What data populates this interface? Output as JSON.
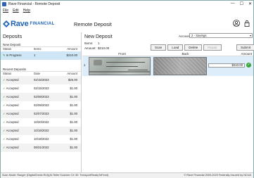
{
  "window": {
    "title": "Rave Financial - Remote Deposit",
    "controls": [
      "—",
      "☐",
      "✕"
    ]
  },
  "menu": {
    "file": "File",
    "edit": "Edit",
    "help": "Help"
  },
  "header": {
    "logo_text": "Rave",
    "logo_sub": "FINANCIAL",
    "title": "Remote Deposit",
    "icons": [
      "user-icon",
      "lock-icon"
    ]
  },
  "left": {
    "title": "Deposits",
    "new_deposit": {
      "label": "New Deposit",
      "columns": [
        "Status",
        "Items",
        "Amount"
      ],
      "rows": [
        {
          "status": "In Progress",
          "items": "1",
          "amount": "$210.00"
        }
      ]
    },
    "recent": {
      "label": "Recent Deposits",
      "columns": [
        "Status",
        "Date",
        "Amount"
      ],
      "rows": [
        {
          "status": "Accepted",
          "date": "02/15/2023",
          "amount": "$25.00"
        },
        {
          "status": "Accepted",
          "date": "02/15/2023",
          "amount": "$1.00"
        },
        {
          "status": "Accepted",
          "date": "02/08/2023",
          "amount": "$1.00"
        },
        {
          "status": "Accepted",
          "date": "02/08/2023",
          "amount": "$1.00"
        },
        {
          "status": "Accepted",
          "date": "02/07/2023",
          "amount": "$1.00"
        },
        {
          "status": "Accepted",
          "date": "10/20/2022",
          "amount": "$1.00"
        },
        {
          "status": "Accepted",
          "date": "10/18/2022",
          "amount": "$1.00"
        },
        {
          "status": "Accepted",
          "date": "10/18/2022",
          "amount": "$1.00"
        },
        {
          "status": "Accepted",
          "date": "08/31/2022",
          "amount": "$1.00"
        }
      ]
    }
  },
  "right": {
    "title": "New Deposit",
    "account_label": "Account:",
    "account_value": "2 - Savings",
    "items_label": "Items:",
    "items_value": "1",
    "amount_label": "Amount:",
    "amount_value": "$210.00",
    "buttons": {
      "scan": "Scan",
      "load": "Load",
      "delete": "Delete",
      "repair": "Repair",
      "submit": "Submit"
    },
    "columns": {
      "front": "Front",
      "back": "Back",
      "amount": "Amount"
    },
    "row": {
      "num": "1",
      "amount": "$210.00"
    }
  },
  "status": {
    "left": "Scan Mode: Ranger (DigitalCheck.RUI)(Al-Teller Scanner CX 30: TransportReadyToFeed)",
    "right": "© Rave Financial 2000-2023   Federally Insured by NCUA"
  }
}
